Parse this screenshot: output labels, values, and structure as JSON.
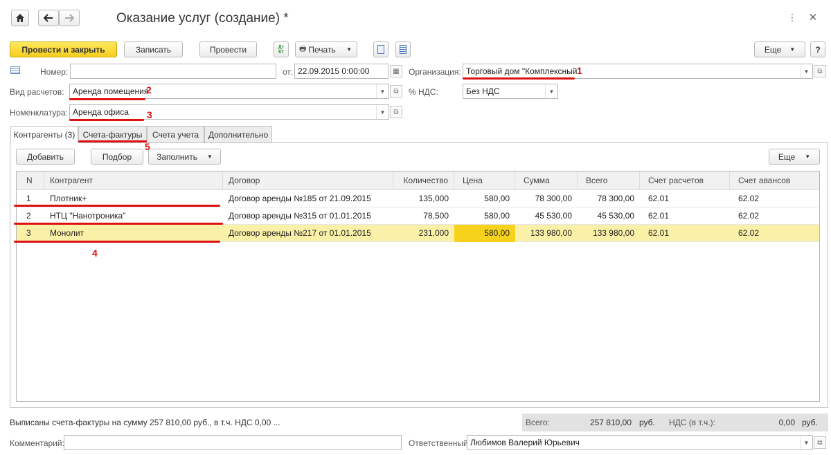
{
  "title": "Оказание услуг (создание) *",
  "nav": {
    "home_icon": "home-icon",
    "back_icon": "arrow-left-icon",
    "forward_icon": "arrow-right-icon"
  },
  "top_right": {
    "more_label": "Еще",
    "help_label": "?"
  },
  "toolbar": {
    "post_close": "Провести и закрыть",
    "save": "Записать",
    "post": "Провести",
    "dt_kt": "Дт Кт",
    "print": "Печать",
    "more": "Еще"
  },
  "form": {
    "number_label": "Номер:",
    "number_value": "",
    "date_label": "от:",
    "date_value": "22.09.2015  0:00:00",
    "org_label": "Организация:",
    "org_value": "Торговый дом \"Комплексный\"",
    "calc_label": "Вид расчетов:",
    "calc_value": "Аренда помещения",
    "vat_label": "% НДС:",
    "vat_value": "Без НДС",
    "nom_label": "Номенклатура:",
    "nom_value": "Аренда офиса"
  },
  "annotations": [
    "1",
    "2",
    "3",
    "4",
    "5"
  ],
  "tabs": [
    {
      "label": "Контрагенты (3)"
    },
    {
      "label": "Счета-фактуры"
    },
    {
      "label": "Счета учета"
    },
    {
      "label": "Дополнительно"
    }
  ],
  "table_toolbar": {
    "add": "Добавить",
    "pick": "Подбор",
    "fill": "Заполнить",
    "more": "Еще"
  },
  "table": {
    "headers": [
      "N",
      "Контрагент",
      "Договор",
      "Количество",
      "Цена",
      "Сумма",
      "Всего",
      "Счет расчетов",
      "Счет авансов"
    ],
    "rows": [
      [
        "1",
        "Плотник+",
        "Договор аренды №185 от 21.09.2015",
        "135,000",
        "580,00",
        "78 300,00",
        "78 300,00",
        "62.01",
        "62.02"
      ],
      [
        "2",
        "НТЦ \"Нанотроника\"",
        "Договор аренды №315 от 01.01.2015",
        "78,500",
        "580,00",
        "45 530,00",
        "45 530,00",
        "62.01",
        "62.02"
      ],
      [
        "3",
        "Монолит",
        "Договор аренды №217 от 01.01.2015",
        "231,000",
        "580,00",
        "133 980,00",
        "133 980,00",
        "62.01",
        "62.02"
      ]
    ]
  },
  "footer": {
    "invoices_text": "Выписаны счета-фактуры на сумму 257 810,00 руб., в т.ч. НДС 0,00 ...",
    "total_label": "Всего:",
    "total_value": "257 810,00",
    "currency": "руб.",
    "vat_label": "НДС (в т.ч.):",
    "vat_value": "0,00",
    "vat_currency": "руб.",
    "comment_label": "Комментарий:",
    "comment_value": "",
    "resp_label": "Ответственный:",
    "resp_value": "Любимов Валерий Юрьевич"
  },
  "colors": {
    "primary_button": "#f5cd1f",
    "selected_row": "#fbf0a8",
    "annotation": "#dd1111"
  }
}
